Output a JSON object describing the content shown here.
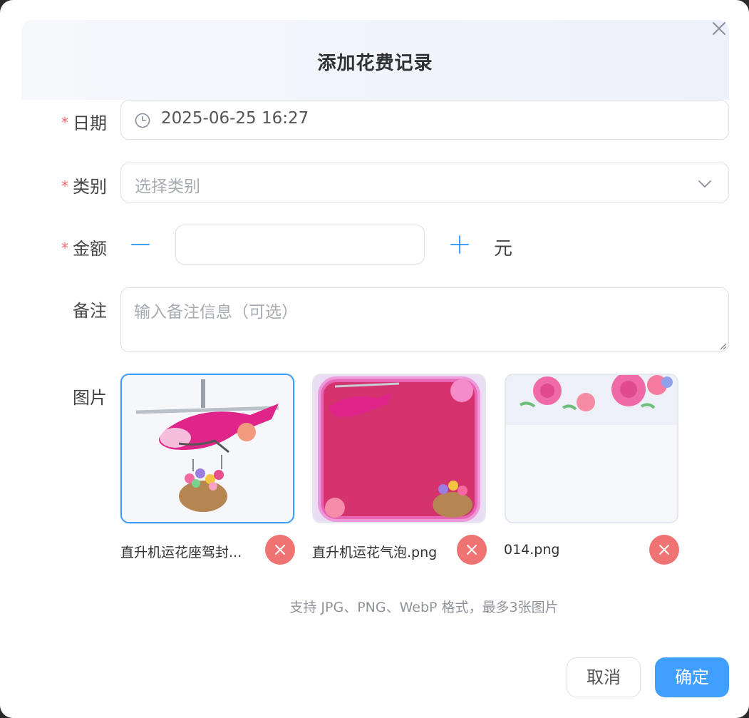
{
  "dialog": {
    "title": "添加花费记录"
  },
  "form": {
    "date": {
      "label": "日期",
      "value": "2025-06-25 16:27"
    },
    "category": {
      "label": "类别",
      "placeholder": "选择类别"
    },
    "amount": {
      "label": "金额",
      "value": "",
      "unit": "元"
    },
    "note": {
      "label": "备注",
      "placeholder": "输入备注信息（可选）"
    },
    "images": {
      "label": "图片",
      "items": [
        {
          "name": "直升机运花座驾封...",
          "selected": true
        },
        {
          "name": "直升机运花气泡.png",
          "selected": false
        },
        {
          "name": "014.png",
          "selected": false
        }
      ],
      "hint": "支持 JPG、PNG、WebP 格式，最多3张图片"
    }
  },
  "actions": {
    "cancel": "取消",
    "confirm": "确定"
  },
  "colors": {
    "primary": "#409eff",
    "danger": "#f07373",
    "required": "#f56c6c"
  }
}
